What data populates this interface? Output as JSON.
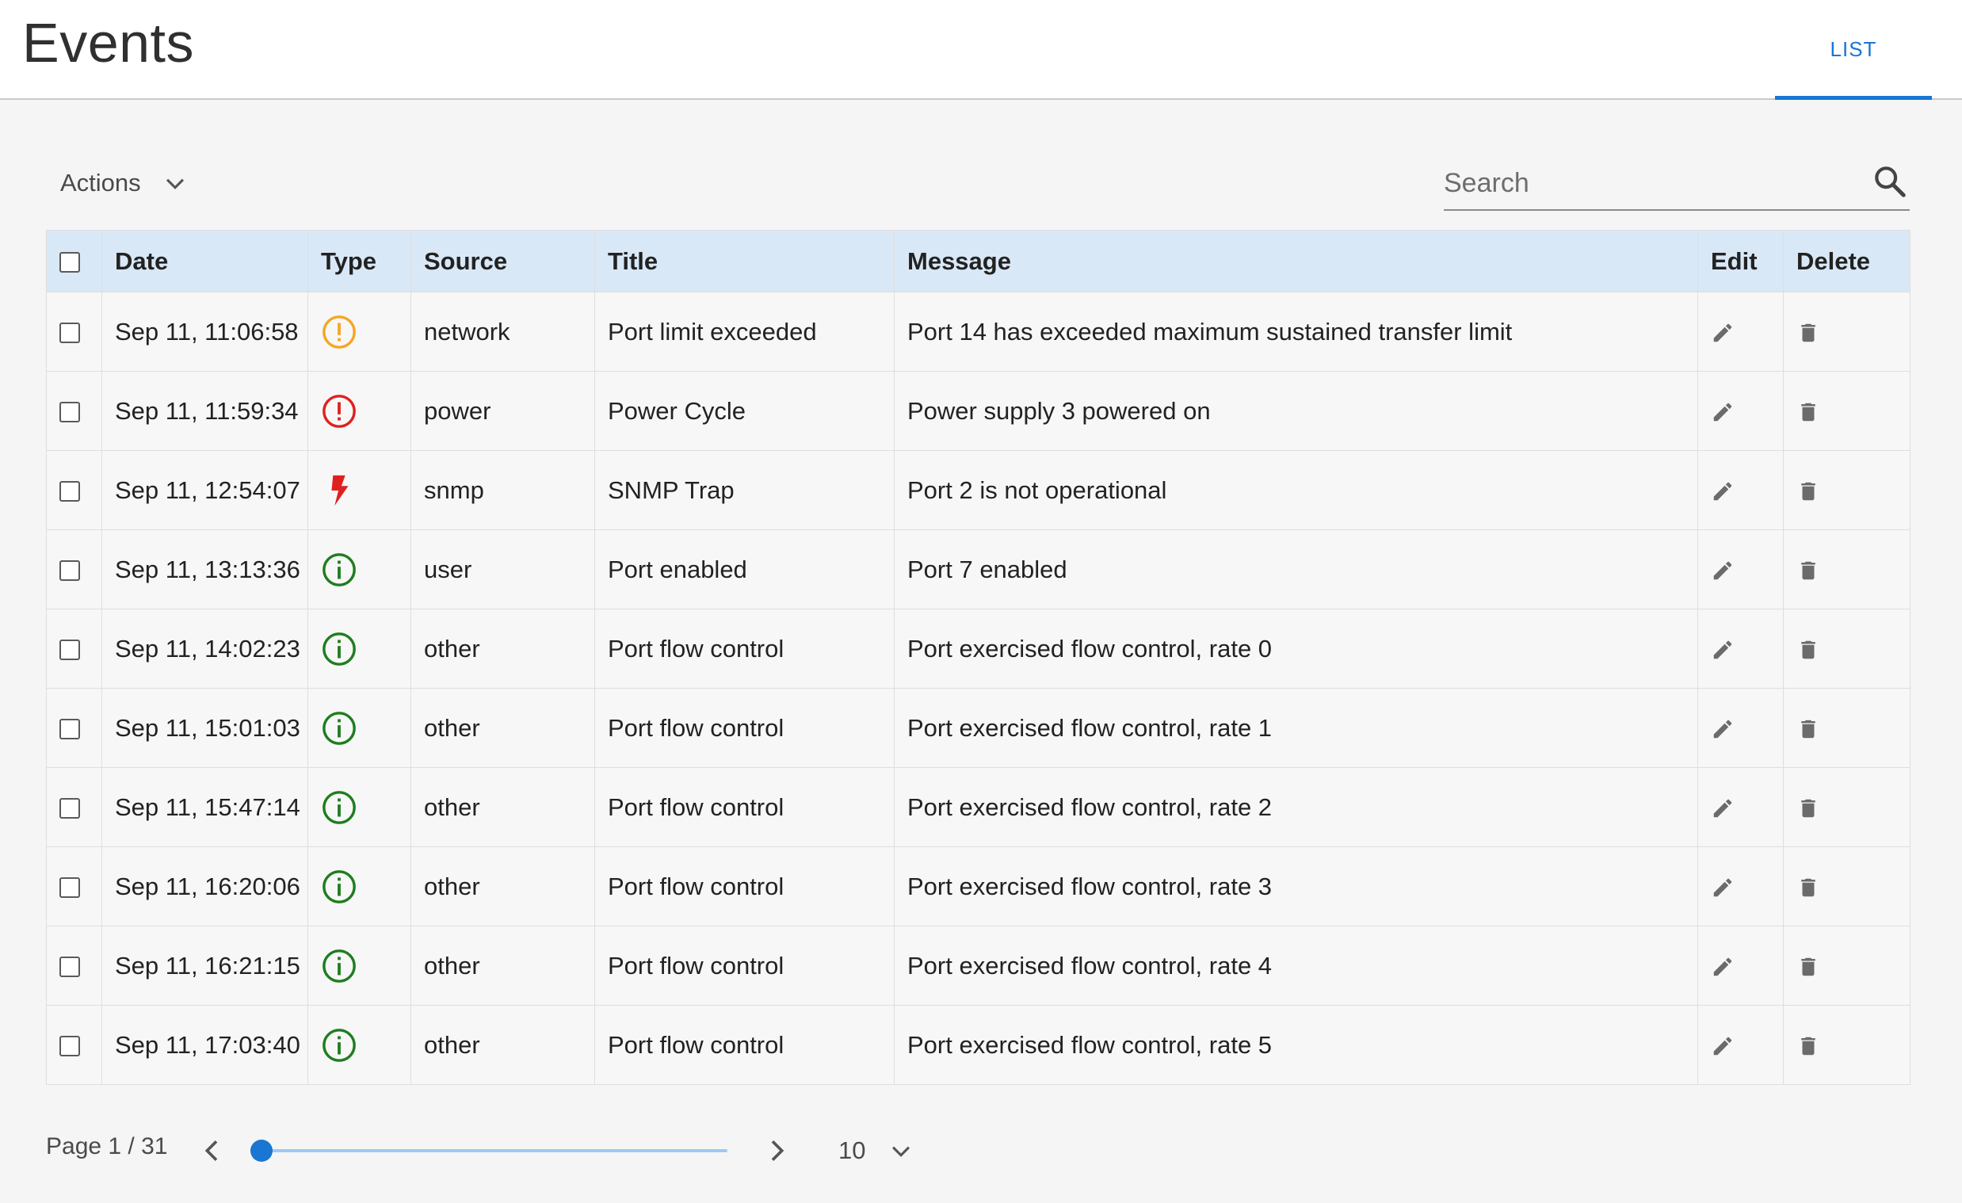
{
  "header": {
    "title": "Events",
    "tab": "LIST"
  },
  "toolbar": {
    "actions_label": "Actions",
    "search_placeholder": "Search"
  },
  "table": {
    "columns": [
      "Date",
      "Type",
      "Source",
      "Title",
      "Message",
      "Edit",
      "Delete"
    ],
    "rows": [
      {
        "date": "Sep 11, 11:06:58",
        "type": "warning",
        "source": "network",
        "title": "Port limit exceeded",
        "message": "Port 14 has exceeded maximum sustained transfer limit"
      },
      {
        "date": "Sep 11, 11:59:34",
        "type": "error",
        "source": "power",
        "title": "Power Cycle",
        "message": "Power supply 3 powered on"
      },
      {
        "date": "Sep 11, 12:54:07",
        "type": "trap",
        "source": "snmp",
        "title": "SNMP Trap",
        "message": "Port 2 is not operational"
      },
      {
        "date": "Sep 11, 13:13:36",
        "type": "info",
        "source": "user",
        "title": "Port enabled",
        "message": "Port 7 enabled"
      },
      {
        "date": "Sep 11, 14:02:23",
        "type": "info",
        "source": "other",
        "title": "Port flow control",
        "message": "Port exercised flow control, rate 0"
      },
      {
        "date": "Sep 11, 15:01:03",
        "type": "info",
        "source": "other",
        "title": "Port flow control",
        "message": "Port exercised flow control, rate 1"
      },
      {
        "date": "Sep 11, 15:47:14",
        "type": "info",
        "source": "other",
        "title": "Port flow control",
        "message": "Port exercised flow control, rate 2"
      },
      {
        "date": "Sep 11, 16:20:06",
        "type": "info",
        "source": "other",
        "title": "Port flow control",
        "message": "Port exercised flow control, rate 3"
      },
      {
        "date": "Sep 11, 16:21:15",
        "type": "info",
        "source": "other",
        "title": "Port flow control",
        "message": "Port exercised flow control, rate 4"
      },
      {
        "date": "Sep 11, 17:03:40",
        "type": "info",
        "source": "other",
        "title": "Port flow control",
        "message": "Port exercised flow control, rate 5"
      }
    ]
  },
  "type_icons": {
    "warning": {
      "icon": "warning-icon",
      "color": "#f5a623"
    },
    "error": {
      "icon": "error-icon",
      "color": "#e02020"
    },
    "trap": {
      "icon": "lightning-icon",
      "color": "#e02020"
    },
    "info": {
      "icon": "info-icon",
      "color": "#1e7d1e"
    }
  },
  "pagination": {
    "label": "Page 1 / 31",
    "current_page": 1,
    "total_pages": 31,
    "page_size": "10"
  },
  "colors": {
    "accent": "#1976d2",
    "header_row": "#d9e8f6"
  }
}
